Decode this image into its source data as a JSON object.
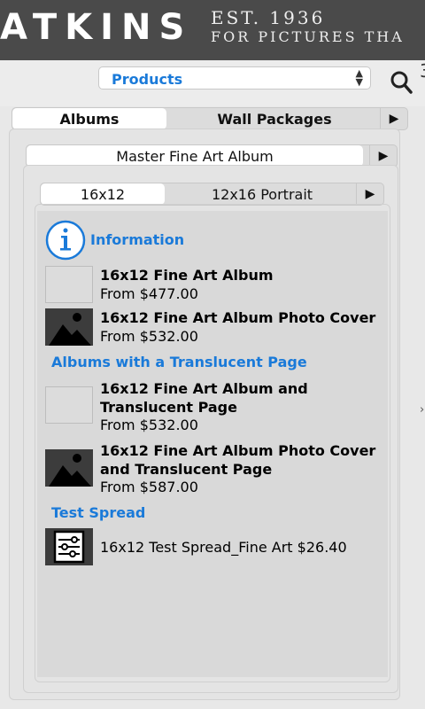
{
  "header": {
    "brand": "ATKINS",
    "tag_line1": "EST. 1936",
    "tag_line2": "FOR PICTURES THA"
  },
  "toolbar": {
    "dropdown_value": "Products",
    "search_icon": "search-icon"
  },
  "tabs_level1": [
    {
      "label": "Albums",
      "active": true
    },
    {
      "label": "Wall Packages",
      "active": false
    }
  ],
  "tabs_level2": [
    {
      "label": "Master Fine Art Album",
      "active": true
    }
  ],
  "tabs_level3": [
    {
      "label": "16x12",
      "active": true
    },
    {
      "label": "12x16 Portrait",
      "active": false
    }
  ],
  "information_label": "Information",
  "items": {
    "item1": {
      "name": "16x12 Fine Art Album",
      "price": "From $477.00"
    },
    "item2": {
      "name": "16x12 Fine Art Album Photo Cover",
      "price": "From $532.00"
    },
    "section2": "Albums with a Translucent Page",
    "item3": {
      "name_line1": "16x12 Fine Art Album and",
      "name_line2": "Translucent Page",
      "price": "From $532.00"
    },
    "item4": {
      "name_line1": "16x12 Fine Art Album Photo Cover",
      "name_line2": "and Translucent Page",
      "price": "From $587.00"
    },
    "section3": "Test Spread",
    "item5": {
      "label": "16x12 Test Spread_Fine Art $26.40"
    }
  },
  "colors": {
    "accent": "#1a7ad9",
    "header_bg": "#4a4a4a"
  }
}
